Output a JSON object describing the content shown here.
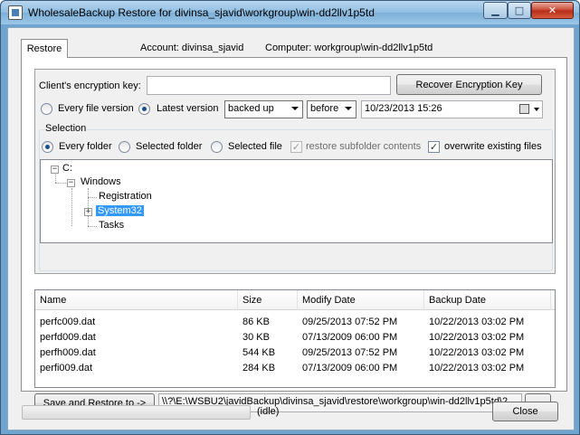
{
  "window": {
    "title": "WholesaleBackup Restore for divinsa_sjavid\\workgroup\\win-dd2llv1p5td",
    "minimize_glyph": "▁",
    "maximize_glyph": "□",
    "close_glyph": "✕"
  },
  "tabs": [
    {
      "label": "Restore"
    }
  ],
  "header": {
    "account": "Account: divinsa_sjavid",
    "computer": "Computer: workgroup\\win-dd2llv1p5td"
  },
  "encryption": {
    "label": "Client's encryption key:",
    "value": "",
    "recover_button": "Recover Encryption Key"
  },
  "version": {
    "every_label": "Every file version",
    "latest_label": "Latest version",
    "selected": "latest",
    "state_combo": "backed up",
    "relation_combo": "before",
    "datetime": "10/23/2013   15:26"
  },
  "selection": {
    "group_label": "Selection",
    "every_folder": "Every folder",
    "selected_folder": "Selected folder",
    "selected_file": "Selected file",
    "selected_mode": "every_folder",
    "restore_subfolder": "restore subfolder contents",
    "restore_subfolder_checked": true,
    "overwrite_existing": "overwrite existing files",
    "overwrite_existing_checked": true
  },
  "tree": {
    "root": "C:",
    "windows": "Windows",
    "registration": "Registration",
    "system32": "System32",
    "tasks": "Tasks",
    "expanded_glyph": "−",
    "collapsed_glyph": "+"
  },
  "file_list": {
    "columns": [
      "Name",
      "Size",
      "Modify Date",
      "Backup Date"
    ],
    "rows": [
      {
        "name": "perfc009.dat",
        "size": "86 KB",
        "modify": "09/25/2013 07:52 PM",
        "backup": "10/22/2013 03:02 PM"
      },
      {
        "name": "perfd009.dat",
        "size": "30 KB",
        "modify": "07/13/2009 06:00 PM",
        "backup": "10/22/2013 03:02 PM"
      },
      {
        "name": "perfh009.dat",
        "size": "544 KB",
        "modify": "09/25/2013 07:52 PM",
        "backup": "10/22/2013 03:02 PM"
      },
      {
        "name": "perfi009.dat",
        "size": "284 KB",
        "modify": "07/13/2009 06:00 PM",
        "backup": "10/22/2013 03:02 PM"
      }
    ]
  },
  "restore": {
    "button": "Save and Restore to ->",
    "path": "\\\\?\\E:\\WSBU2\\javidBackup\\divinsa_sjavid\\restore\\workgroup\\win-dd2llv1p5td\\2",
    "browse_button": "..."
  },
  "status": {
    "progress": 0,
    "text": "(idle)"
  },
  "footer": {
    "close_button": "Close"
  }
}
